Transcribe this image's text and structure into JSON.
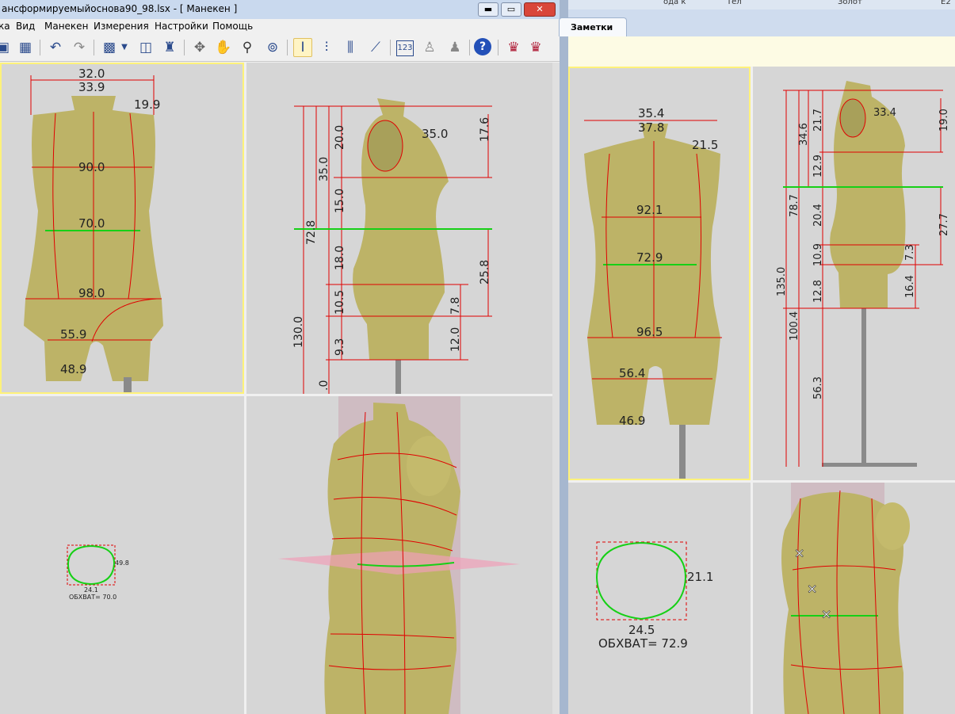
{
  "left_window": {
    "title": "ансформируемыйоснова90_98.lsx - [ Манекен ]",
    "window_buttons": {
      "minimize": "▬",
      "restore": "▭",
      "close": "✕"
    },
    "menu": [
      "ка",
      "Вид",
      "Манекен",
      "Измерения",
      "Настройки",
      "Помощь"
    ],
    "toolbar_icons": [
      "save-icon",
      "print-setup-icon",
      "undo-icon",
      "redo-icon",
      "view-select-icon",
      "dropdown-arrow-icon",
      "layout-icon",
      "mannequin-settings-icon",
      "rotate-icon",
      "pan-hand-icon",
      "zoom-icon",
      "fit-view-icon",
      "vertical-measure-icon",
      "vertical-measure-dashed-icon",
      "girth-measure-icon",
      "ruler-icon",
      "numbers-icon",
      "mannequin-adjust-icon",
      "mannequin-add-icon",
      "help-icon",
      "dress-form-icon",
      "dress-form-edit-icon"
    ],
    "front_view": {
      "labels": [
        "32.0",
        "33.9",
        "19.9",
        "90.0",
        "70.0",
        "98.0",
        "55.9",
        "48.9"
      ]
    },
    "side_view": {
      "labels": [
        "35.0",
        "17.6",
        "20.0",
        "35.0",
        "15.0",
        "72.8",
        "18.0",
        "25.8",
        "10.5",
        "7.8",
        "130.0",
        "9.3",
        "12.0",
        ".0"
      ]
    },
    "section_view": {
      "width_label": "49.8",
      "depth_label": "24.1",
      "girth_label": "ОБХВАТ= 70.0"
    }
  },
  "right_window": {
    "topbar": [
      "ода к",
      "Тел",
      "Золот",
      "Е2"
    ],
    "tab": "Заметки",
    "front_view": {
      "labels": [
        "35.4",
        "37.8",
        "21.5",
        "92.1",
        "72.9",
        "96.5",
        "56.4",
        "46.9"
      ]
    },
    "side_view": {
      "labels": [
        "33.4",
        "19.0",
        "34.6",
        "21.7",
        "12.9",
        "78.7",
        "20.4",
        "27.7",
        "10.9",
        "7.3",
        "135.0",
        "12.8",
        "16.4",
        "100.4",
        "56.3"
      ]
    },
    "section_view": {
      "width_label": "21.1",
      "depth_label": "24.5",
      "girth_label": "ОБХВАТ= 72.9"
    }
  },
  "colors": {
    "background_view": "#d6d6d6",
    "mannequin": "#bdb367",
    "measure_line": "#e00000",
    "waist_line": "#16d016",
    "active_frame": "#fff27a"
  }
}
